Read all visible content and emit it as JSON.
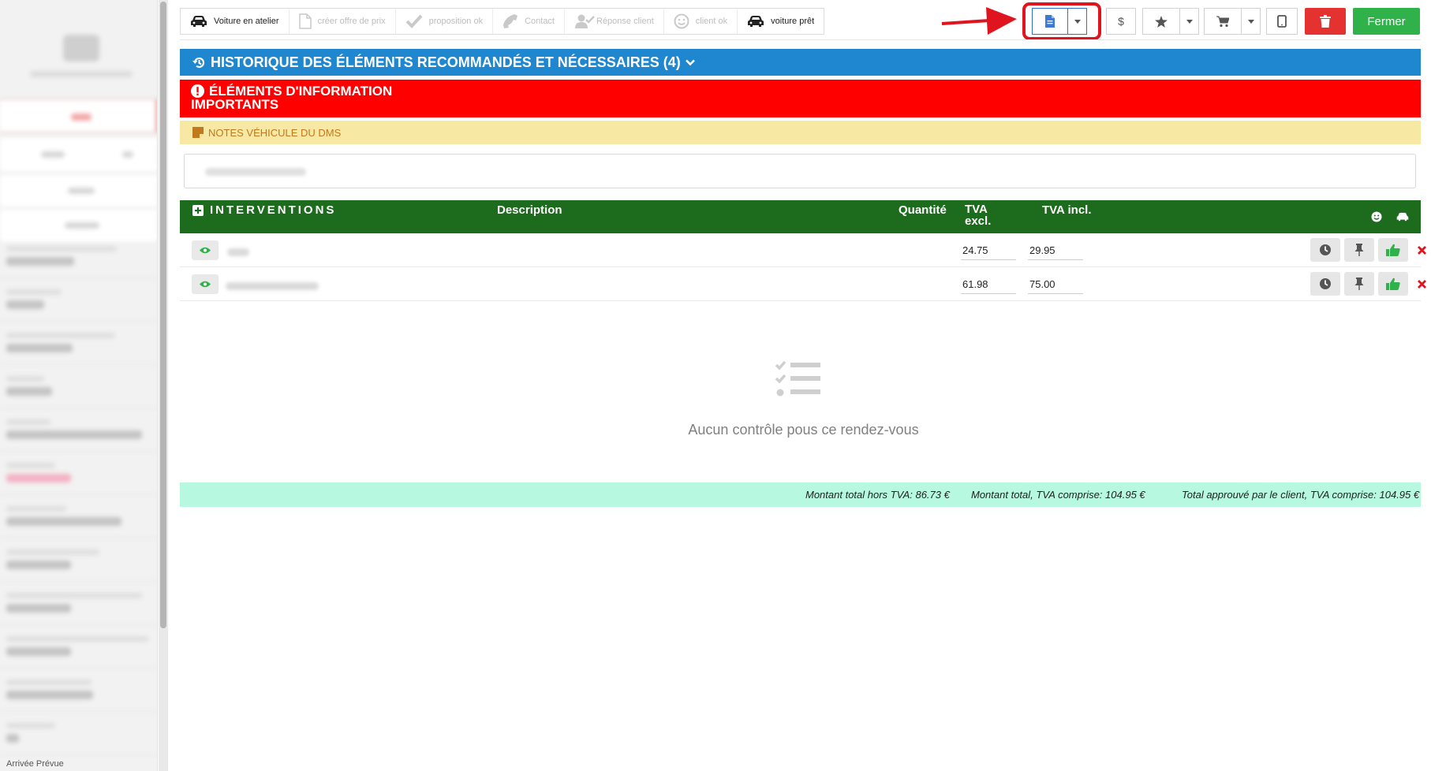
{
  "workflow_steps": [
    {
      "label": "Voiture en atelier",
      "icon": "car-icon",
      "done": true
    },
    {
      "label": "créer offre de prix",
      "icon": "document-icon",
      "done": false
    },
    {
      "label": "proposition ok",
      "icon": "check-icon",
      "done": false
    },
    {
      "label": "Contact",
      "icon": "phone-icon",
      "done": false
    },
    {
      "label": "Réponse client",
      "icon": "user-check-icon",
      "done": false
    },
    {
      "label": "client ok",
      "icon": "smile-icon",
      "done": false
    },
    {
      "label": "voiture prêt",
      "icon": "car-icon",
      "done": true
    }
  ],
  "toolbar": {
    "price_symbol": "$",
    "close_label": "Fermer"
  },
  "history_banner": {
    "title": "HISTORIQUE DES ÉLÉMENTS RECOMMANDÉS ET NÉCESSAIRES (4)"
  },
  "info_banner": {
    "line1": "ÉLÉMENTS D'INFORMATION",
    "line2": "IMPORTANTS"
  },
  "notes_banner": {
    "label": "NOTES VÉHICULE DU DMS"
  },
  "interventions": {
    "title": "INTERVENTIONS",
    "col_description": "Description",
    "col_quantity": "Quantité",
    "col_vat_excl_1": "TVA",
    "col_vat_excl_2": "excl.",
    "col_vat_incl": "TVA incl.",
    "rows": [
      {
        "price_excl": "24.75",
        "price_incl": "29.95"
      },
      {
        "price_excl": "61.98",
        "price_incl": "75.00"
      }
    ]
  },
  "empty_state": {
    "message": "Aucun contrôle pous ce rendez-vous"
  },
  "totals": {
    "total_excl": "Montant total hors TVA: 86.73 €",
    "total_incl": "Montant total, TVA comprise: 104.95 €",
    "total_approved": "Total approuvé par le client, TVA comprise: 104.95 €"
  },
  "sidebar": {
    "footer_label": "Arrivée Prévue"
  },
  "colors": {
    "history_blue": "#1f86d0",
    "info_red": "#ff0000",
    "notes_yellow": "#f7e8a4",
    "interventions_green": "#1d6b1d",
    "totals_mint": "#b6f8e0",
    "close_green": "#2fb24a",
    "delete_red": "#e3322f",
    "annotation_red": "#e0141e"
  }
}
